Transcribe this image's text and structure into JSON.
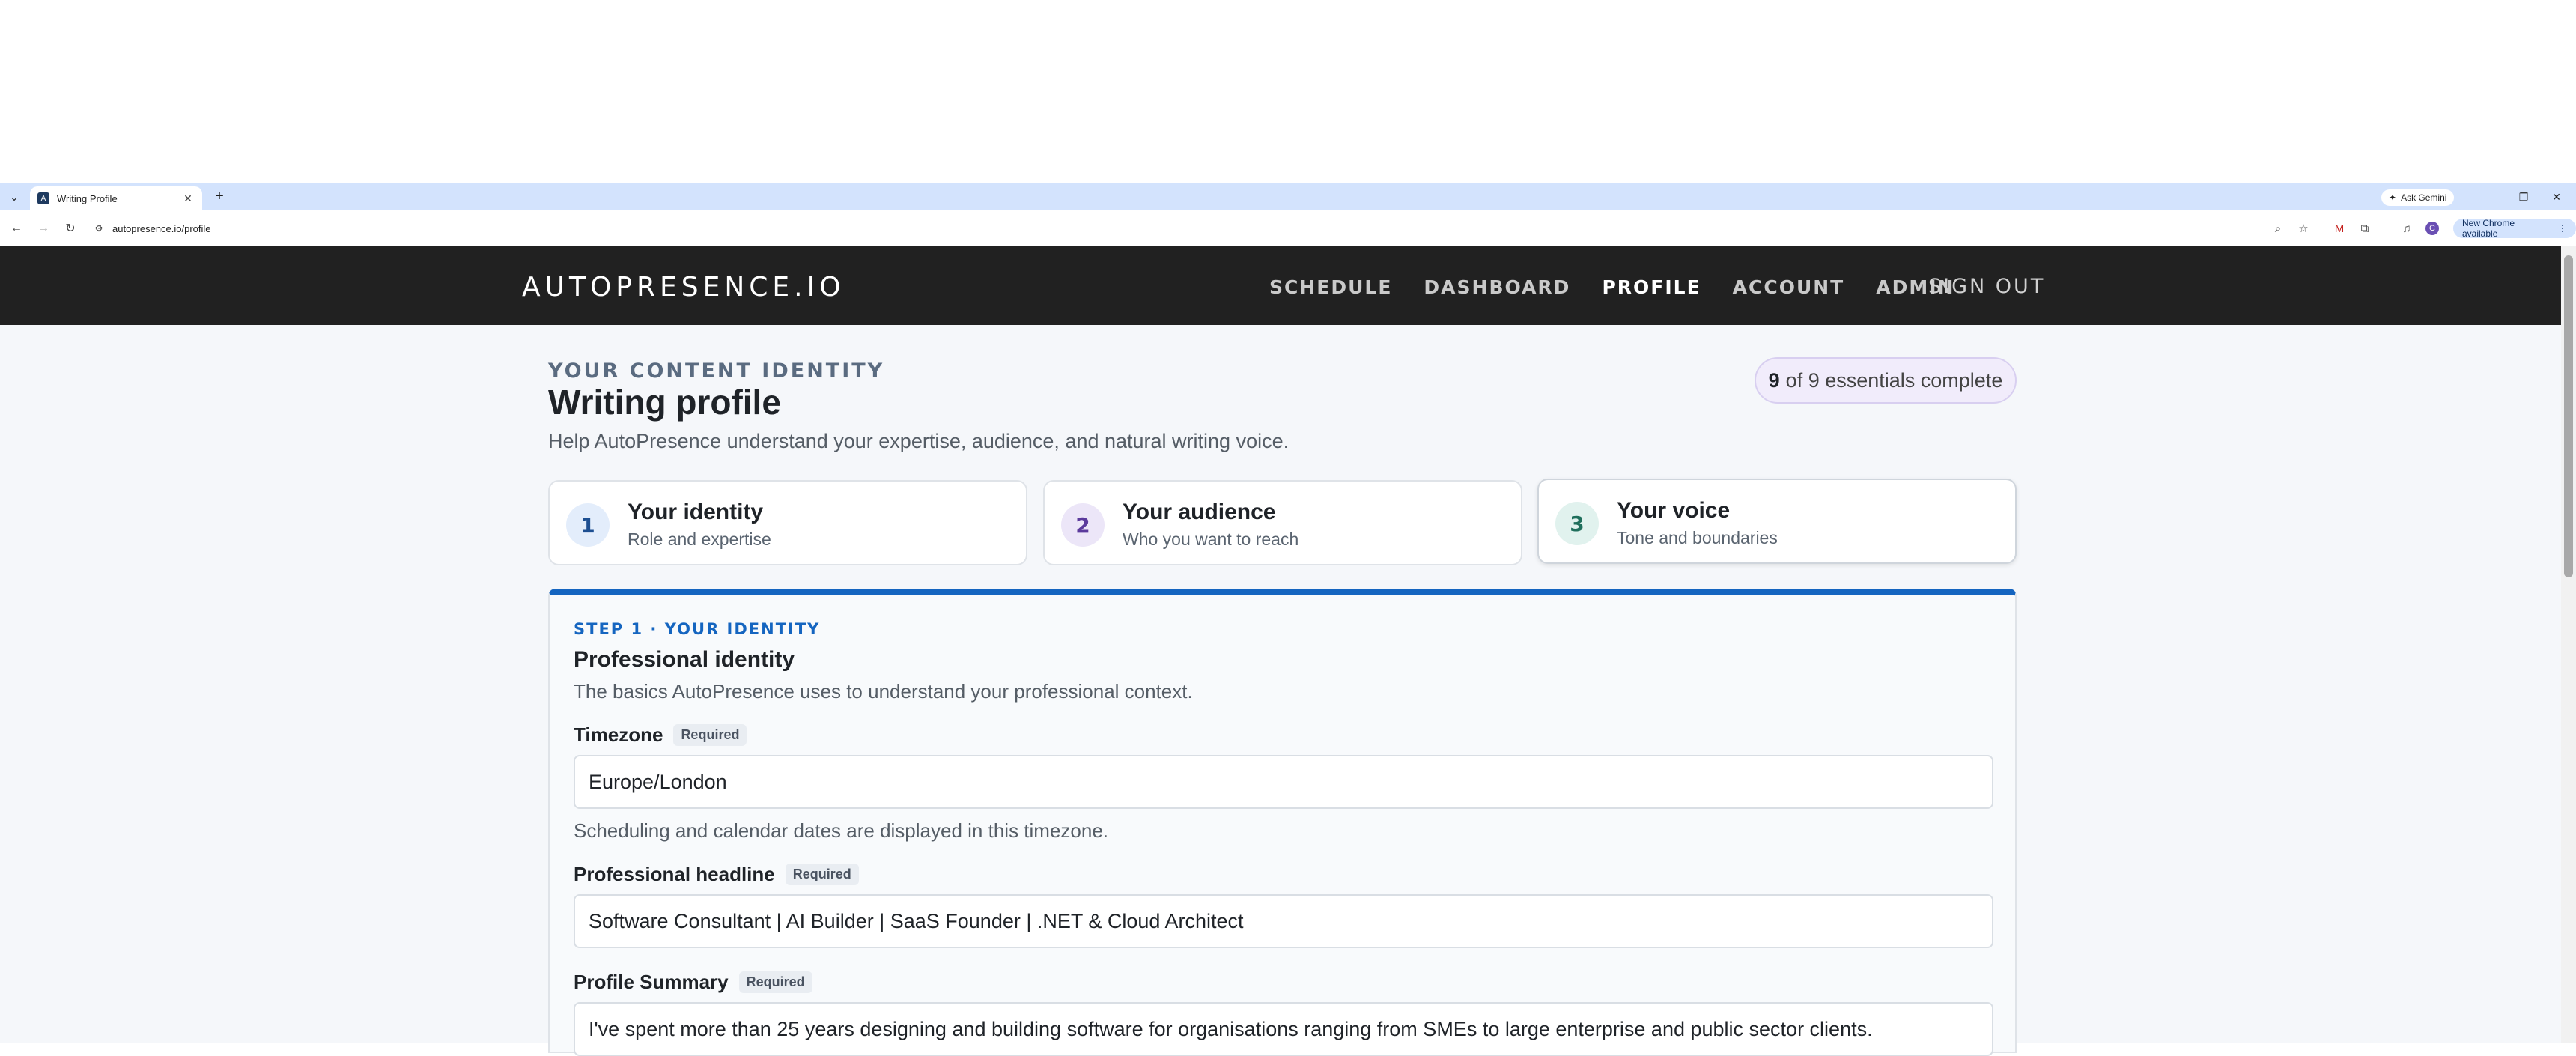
{
  "browser": {
    "tab_title": "Writing Profile",
    "tab_favicon_letter": "A",
    "url": "autopresence.io/profile",
    "ask_gemini": "Ask Gemini",
    "chrome_update": "New Chrome available",
    "profile_initial": "C"
  },
  "site": {
    "logo": "AUTOPRESENCE.IO",
    "nav": [
      "SCHEDULE",
      "DASHBOARD",
      "PROFILE",
      "ACCOUNT",
      "ADMIN"
    ],
    "active_nav": "PROFILE",
    "sign_out": "SIGN OUT"
  },
  "page": {
    "eyebrow": "YOUR CONTENT IDENTITY",
    "title": "Writing profile",
    "subtitle": "Help AutoPresence understand your expertise, audience, and natural writing voice.",
    "progress_count": "9",
    "progress_rest": "of 9 essentials complete"
  },
  "steps": [
    {
      "number": "1",
      "title": "Your identity",
      "subtitle": "Role and expertise",
      "num_bg": "#e3edfb",
      "num_color": "#1d4f91"
    },
    {
      "number": "2",
      "title": "Your audience",
      "subtitle": "Who you want to reach",
      "num_bg": "#ece6f8",
      "num_color": "#5b3a9c"
    },
    {
      "number": "3",
      "title": "Your voice",
      "subtitle": "Tone and boundaries",
      "num_bg": "#e1f2ee",
      "num_color": "#1f6f5c"
    }
  ],
  "form": {
    "eyebrow": "STEP 1 · YOUR IDENTITY",
    "title": "Professional identity",
    "description": "The basics AutoPresence uses to understand your professional context.",
    "required_label": "Required",
    "timezone": {
      "label": "Timezone",
      "value": "Europe/London",
      "help": "Scheduling and calendar dates are displayed in this timezone."
    },
    "headline": {
      "label": "Professional headline",
      "value": "Software Consultant | AI Builder | SaaS Founder | .NET & Cloud Architect"
    },
    "summary": {
      "label": "Profile Summary",
      "value": "I've spent more than 25 years designing and building software for organisations ranging from SMEs to large enterprise and public sector clients."
    }
  },
  "colors": {
    "header_bg": "#212121",
    "accent_blue": "#1565c0",
    "page_bg": "#f5f7fa"
  }
}
